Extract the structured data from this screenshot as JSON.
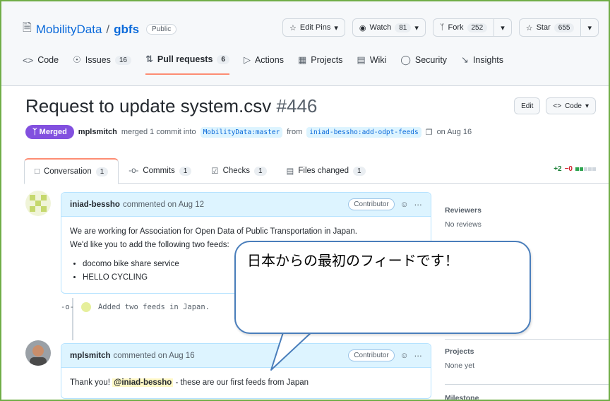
{
  "repo": {
    "owner": "MobilityData",
    "separator": "/",
    "name": "gbfs",
    "visibility": "Public",
    "edit_pins": "Edit Pins",
    "watch": "Watch",
    "watch_count": "81",
    "fork": "Fork",
    "fork_count": "252",
    "star": "Star",
    "star_count": "655"
  },
  "nav": {
    "code": "Code",
    "issues": "Issues",
    "issues_count": "16",
    "pulls": "Pull requests",
    "pulls_count": "6",
    "actions": "Actions",
    "projects": "Projects",
    "wiki": "Wiki",
    "security": "Security",
    "insights": "Insights"
  },
  "pr": {
    "title": "Request to update system.csv",
    "number": "#446",
    "edit": "Edit",
    "code": "Code",
    "state": "Merged",
    "author": "mplsmitch",
    "meta_text": "merged 1 commit into",
    "base": "MobilityData:master",
    "from": "from",
    "head": "iniad-bessho:add-odpt-feeds",
    "date": "on Aug 16"
  },
  "pr_tabs": {
    "conversation": "Conversation",
    "conversation_count": "1",
    "commits": "Commits",
    "commits_count": "1",
    "checks": "Checks",
    "checks_count": "1",
    "files": "Files changed",
    "files_count": "1",
    "additions": "+2",
    "deletions": "−0"
  },
  "comments": [
    {
      "author": "iniad-bessho",
      "when": "commented on Aug 12",
      "role": "Contributor",
      "line1": "We are working for Association for Open Data of Public Transportation in Japan.",
      "line2": "We'd like you to add the following two feeds:",
      "bullets": [
        "docomo bike share service",
        "HELLO CYCLING"
      ]
    },
    {
      "author": "mplsmitch",
      "when": "commented on Aug 16",
      "role": "Contributor",
      "prefix": "Thank you!",
      "mention": "@iniad-bessho",
      "suffix": "- these are our first feeds from Japan"
    }
  ],
  "commit": {
    "message": "Added two feeds in Japan."
  },
  "sidebar": {
    "reviewers_label": "Reviewers",
    "reviewers_value": "No reviews",
    "projects_label": "Projects",
    "projects_value": "None yet",
    "milestone_label": "Milestone"
  },
  "callout": {
    "text": "日本からの最初のフィードです！"
  },
  "colors": {
    "merged": "#8250df",
    "link": "#0969da",
    "frame": "#70ad47",
    "callout_border": "#4a7ebb"
  }
}
